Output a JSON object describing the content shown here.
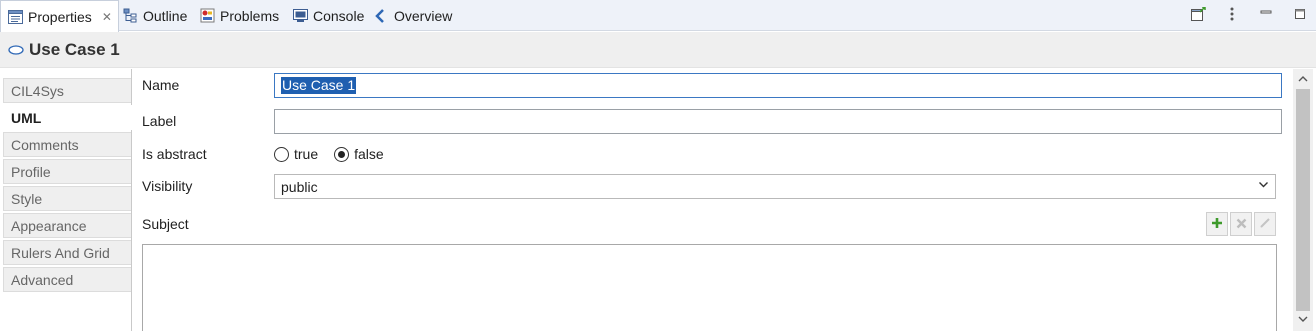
{
  "tabs": [
    {
      "label": "Properties",
      "active": true,
      "icon": "properties-icon",
      "closable": true
    },
    {
      "label": "Outline",
      "active": false,
      "icon": "outline-icon"
    },
    {
      "label": "Problems",
      "active": false,
      "icon": "problems-icon"
    },
    {
      "label": "Console",
      "active": false,
      "icon": "console-icon"
    },
    {
      "label": "Overview",
      "active": false,
      "icon": "overview-icon"
    }
  ],
  "view_tools": [
    "open-view-icon",
    "view-menu-icon",
    "minimize-icon",
    "maximize-icon"
  ],
  "header": {
    "title": "Use Case 1",
    "icon": "use-case-icon"
  },
  "sections": [
    {
      "label": "CIL4Sys",
      "selected": false
    },
    {
      "label": "UML",
      "selected": true
    },
    {
      "label": "Comments",
      "selected": false
    },
    {
      "label": "Profile",
      "selected": false
    },
    {
      "label": "Style",
      "selected": false
    },
    {
      "label": "Appearance",
      "selected": false
    },
    {
      "label": "Rulers And Grid",
      "selected": false
    },
    {
      "label": "Advanced",
      "selected": false
    }
  ],
  "form": {
    "name_label": "Name",
    "name_value": "Use Case 1",
    "label_label": "Label",
    "label_value": "",
    "abstract_label": "Is abstract",
    "abstract_options": [
      {
        "label": "true",
        "checked": false
      },
      {
        "label": "false",
        "checked": true
      }
    ],
    "visibility_label": "Visibility",
    "visibility_value": "public",
    "subject_label": "Subject",
    "subject_tools": [
      "add-icon",
      "delete-icon",
      "edit-icon"
    ]
  },
  "colors": {
    "selection": "#1f5fb0",
    "focus_border": "#3b78c3",
    "add_green": "#3e9a2b"
  }
}
